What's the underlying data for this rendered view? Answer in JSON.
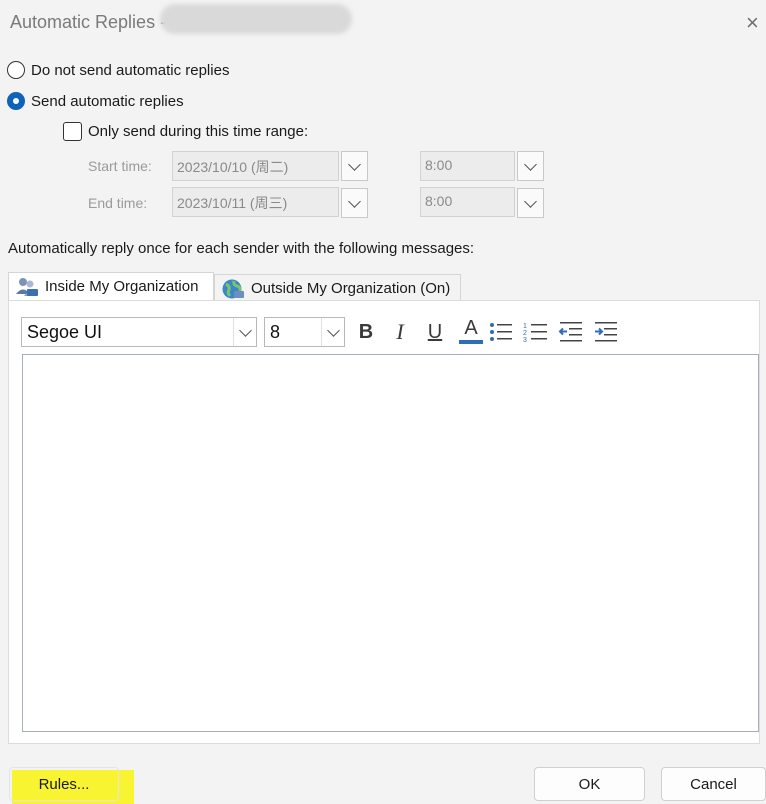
{
  "window": {
    "title": "Automatic Replies -",
    "close_glyph": "×"
  },
  "options": {
    "do_not_send": "Do not send automatic replies",
    "send": "Send automatic replies",
    "time_range": "Only send during this time range:"
  },
  "time": {
    "start_label": "Start time:",
    "start_date": "2023/10/10 (周二)",
    "start_time": "8:00",
    "end_label": "End time:",
    "end_date": "2023/10/11 (周三)",
    "end_time": "8:00"
  },
  "info_text": "Automatically reply once for each sender with the following messages:",
  "tabs": [
    {
      "label": "Inside My Organization",
      "icon": "people-icon"
    },
    {
      "label": "Outside My Organization (On)",
      "icon": "globe-icon"
    }
  ],
  "toolbar": {
    "font": "Segoe UI",
    "size": "8",
    "bold": "B",
    "italic": "I",
    "underline": "U",
    "font_color": "A"
  },
  "footer": {
    "rules": "Rules...",
    "ok": "OK",
    "cancel": "Cancel"
  },
  "colors": {
    "accent": "#0f62b9",
    "highlight": "#f9f431"
  }
}
